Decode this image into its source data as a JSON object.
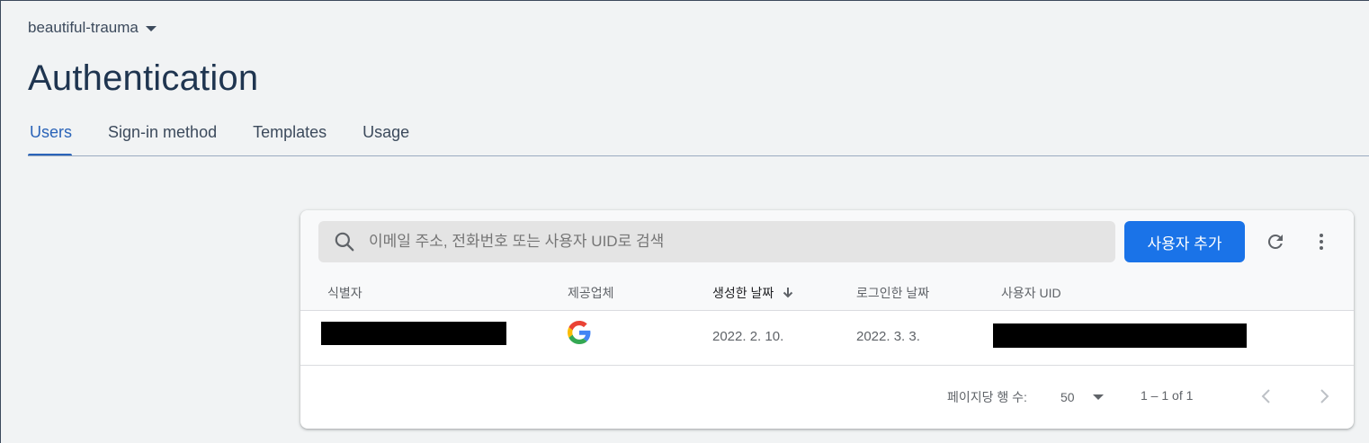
{
  "project": {
    "name": "beautiful-trauma"
  },
  "page": {
    "title": "Authentication"
  },
  "tabs": [
    {
      "label": "Users",
      "active": true
    },
    {
      "label": "Sign-in method",
      "active": false
    },
    {
      "label": "Templates",
      "active": false
    },
    {
      "label": "Usage",
      "active": false
    }
  ],
  "toolbar": {
    "search_placeholder": "이메일 주소, 전화번호 또는 사용자 UID로 검색",
    "search_value": "",
    "add_user_label": "사용자 추가",
    "refresh_icon": "refresh-icon",
    "more_icon": "more-vert-icon"
  },
  "table": {
    "columns": [
      "식별자",
      "제공업체",
      "생성한 날짜",
      "로그인한 날짜",
      "사용자 UID"
    ],
    "sorted_column": "생성한 날짜",
    "sort_direction": "descending",
    "rows": [
      {
        "identifier": "",
        "identifier_redacted": true,
        "provider": "google-icon",
        "created": "2022. 2. 10.",
        "signed_in": "2022. 3. 3.",
        "uid": "",
        "uid_redacted": true
      }
    ]
  },
  "pagination": {
    "rows_per_page_label": "페이지당 행 수:",
    "rows_per_page": "50",
    "range": "1 – 1 of 1"
  },
  "colors": {
    "accent": "#1a73e8",
    "tab_active": "#2a63b8",
    "title": "#1f3550",
    "background": "#f1f3f4"
  }
}
